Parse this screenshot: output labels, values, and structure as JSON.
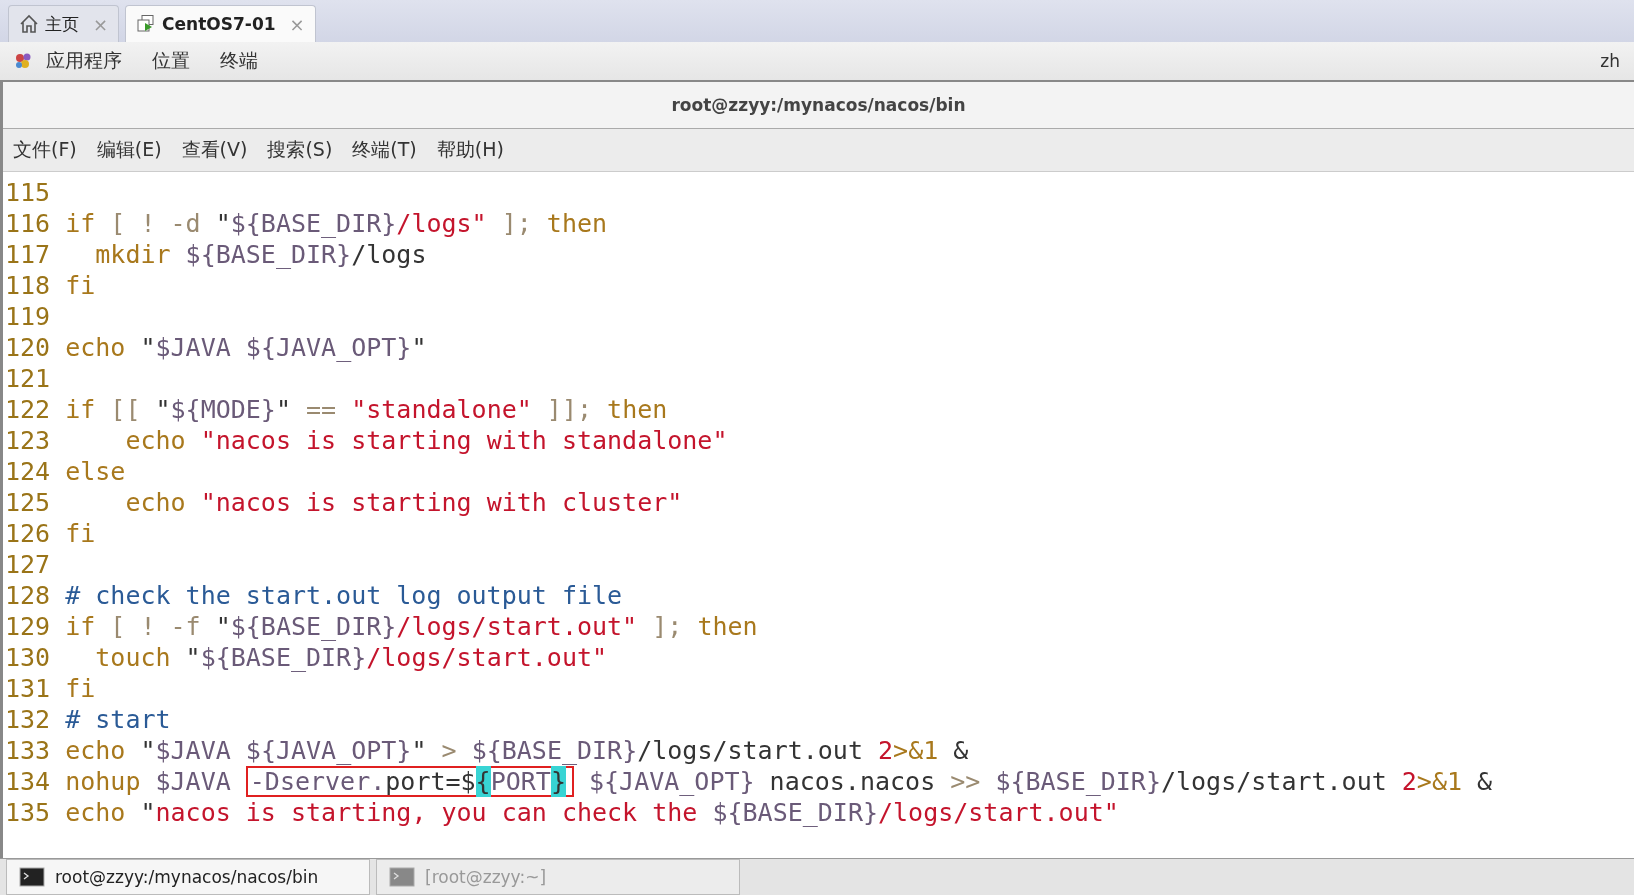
{
  "tabs": [
    {
      "label": "主页",
      "close": "×",
      "selected": false
    },
    {
      "label": "CentOS7-01",
      "close": "×",
      "selected": true
    }
  ],
  "desktop_menu": {
    "items": [
      "应用程序",
      "位置",
      "终端"
    ],
    "language": "zh"
  },
  "window": {
    "title": "root@zzyy:/mynacos/nacos/bin"
  },
  "menu": [
    "文件(F)",
    "编辑(E)",
    "查看(V)",
    "搜索(S)",
    "终端(T)",
    "帮助(H)"
  ],
  "code": [
    {
      "num": "115"
    },
    {
      "num": "116",
      "tokens": [
        {
          "kind": "kw",
          "text": "if"
        },
        {
          "kind": "op",
          "text": " [ ! -d"
        },
        {
          "kind": "txt",
          "text": " \""
        },
        {
          "kind": "var",
          "text": "${BASE_DIR}"
        },
        {
          "kind": "str",
          "text": "/logs\""
        },
        {
          "kind": "op",
          "text": " ];"
        },
        {
          "kind": "kw",
          "text": " then"
        }
      ]
    },
    {
      "num": "117",
      "tokens": [
        {
          "kind": "kw",
          "text": "  mkdir"
        },
        {
          "kind": "var",
          "text": " ${BASE_DIR}"
        },
        {
          "kind": "txt",
          "text": "/logs"
        }
      ]
    },
    {
      "num": "118",
      "tokens": [
        {
          "kind": "kw",
          "text": "fi"
        }
      ]
    },
    {
      "num": "119"
    },
    {
      "num": "120",
      "tokens": [
        {
          "kind": "kw",
          "text": "echo"
        },
        {
          "kind": "txt",
          "text": " \""
        },
        {
          "kind": "var",
          "text": "$JAVA"
        },
        {
          "kind": "var",
          "text": " ${JAVA_OPT}"
        },
        {
          "kind": "txt",
          "text": "\""
        }
      ]
    },
    {
      "num": "121"
    },
    {
      "num": "122",
      "tokens": [
        {
          "kind": "kw",
          "text": "if"
        },
        {
          "kind": "op",
          "text": " [["
        },
        {
          "kind": "txt",
          "text": " \""
        },
        {
          "kind": "var",
          "text": "${MODE}"
        },
        {
          "kind": "txt",
          "text": "\""
        },
        {
          "kind": "op",
          "text": " =="
        },
        {
          "kind": "str",
          "text": " \"standalone\""
        },
        {
          "kind": "op",
          "text": " ]];"
        },
        {
          "kind": "kw",
          "text": " then"
        }
      ]
    },
    {
      "num": "123",
      "tokens": [
        {
          "kind": "kw",
          "text": "    echo"
        },
        {
          "kind": "str",
          "text": " \"nacos is starting with standalone\""
        }
      ]
    },
    {
      "num": "124",
      "tokens": [
        {
          "kind": "kw",
          "text": "else"
        }
      ]
    },
    {
      "num": "125",
      "tokens": [
        {
          "kind": "kw",
          "text": "    echo"
        },
        {
          "kind": "str",
          "text": " \"nacos is starting with cluster\""
        }
      ]
    },
    {
      "num": "126",
      "tokens": [
        {
          "kind": "kw",
          "text": "fi"
        }
      ]
    },
    {
      "num": "127"
    },
    {
      "num": "128",
      "tokens": [
        {
          "kind": "cmt",
          "text": "# check the start.out log output file"
        }
      ]
    },
    {
      "num": "129",
      "tokens": [
        {
          "kind": "kw",
          "text": "if"
        },
        {
          "kind": "op",
          "text": " [ ! -f"
        },
        {
          "kind": "txt",
          "text": " \""
        },
        {
          "kind": "var",
          "text": "${BASE_DIR}"
        },
        {
          "kind": "str",
          "text": "/logs/start.out\""
        },
        {
          "kind": "op",
          "text": " ];"
        },
        {
          "kind": "kw",
          "text": " then"
        }
      ]
    },
    {
      "num": "130",
      "tokens": [
        {
          "kind": "kw",
          "text": "  touch"
        },
        {
          "kind": "txt",
          "text": " \""
        },
        {
          "kind": "var",
          "text": "${BASE_DIR}"
        },
        {
          "kind": "str",
          "text": "/logs/start.out\""
        }
      ]
    },
    {
      "num": "131",
      "tokens": [
        {
          "kind": "kw",
          "text": "fi"
        }
      ]
    },
    {
      "num": "132",
      "tokens": [
        {
          "kind": "cmt",
          "text": "# start"
        }
      ]
    },
    {
      "num": "133",
      "tokens": [
        {
          "kind": "kw",
          "text": "echo"
        },
        {
          "kind": "txt",
          "text": " \""
        },
        {
          "kind": "var",
          "text": "$JAVA"
        },
        {
          "kind": "var",
          "text": " ${JAVA_OPT}"
        },
        {
          "kind": "txt",
          "text": "\""
        },
        {
          "kind": "op",
          "text": " >"
        },
        {
          "kind": "var",
          "text": " ${BASE_DIR}"
        },
        {
          "kind": "txt",
          "text": "/logs/start.out"
        },
        {
          "kind": "num",
          "text": " 2"
        },
        {
          "kind": "kw",
          "text": ">&1"
        },
        {
          "kind": "txt",
          "text": " &"
        }
      ]
    },
    {
      "num": "134",
      "tokens": [
        {
          "kind": "kw",
          "text": "nohup"
        },
        {
          "kind": "var",
          "text": " $JAVA "
        },
        {
          "kind": "box",
          "tokens": [
            {
              "kind": "var",
              "text": "-Dserver."
            },
            {
              "kind": "txt",
              "text": "port=$"
            },
            {
              "kind": "hl",
              "text": "{"
            },
            {
              "kind": "var",
              "text": "PORT"
            },
            {
              "kind": "hl",
              "text": "}"
            }
          ]
        },
        {
          "kind": "var",
          "text": " ${JAVA_OPT}"
        },
        {
          "kind": "txt",
          "text": " nacos.nacos"
        },
        {
          "kind": "op",
          "text": " >>"
        },
        {
          "kind": "var",
          "text": " ${BASE_DIR}"
        },
        {
          "kind": "txt",
          "text": "/logs/start.out"
        },
        {
          "kind": "num",
          "text": " 2"
        },
        {
          "kind": "kw",
          "text": ">&1"
        },
        {
          "kind": "txt",
          "text": " &"
        }
      ]
    },
    {
      "num": "135",
      "tokens": [
        {
          "kind": "kw",
          "text": "echo"
        },
        {
          "kind": "txt",
          "text": " \""
        },
        {
          "kind": "str",
          "text": "nacos is starting, you can check the"
        },
        {
          "kind": "var",
          "text": " ${BASE_DIR}"
        },
        {
          "kind": "str",
          "text": "/logs/start.out\""
        }
      ]
    }
  ],
  "taskbar": [
    {
      "label": "root@zzyy:/mynacos/nacos/bin",
      "selected": true
    },
    {
      "label": "[root@zzyy:~]",
      "selected": false
    }
  ]
}
